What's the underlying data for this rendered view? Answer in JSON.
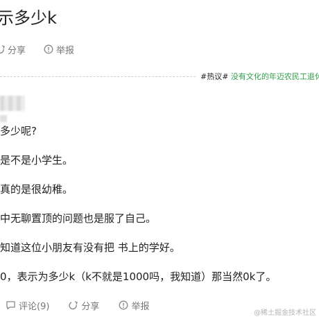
{
  "post": {
    "title": "示多少k"
  },
  "top_actions": {
    "share_label": "分享",
    "report_label": "举报"
  },
  "hashtag": {
    "prefix": "#热议#",
    "topic": " 没有文化的年迈农民工退休..."
  },
  "content": {
    "paragraphs": [
      "多少呢?",
      "是不是小学生。",
      "真的是很幼稚。",
      "中无聊置顶的问题也是服了自己。",
      "知道这位小朋友有没有把 书上的学好。",
      "0，表示为多少k（k不就是1000吗，我知道）那当然0k了。"
    ]
  },
  "bottom_actions": {
    "comment_label": "评论(9)",
    "share_label": "分享",
    "report_label": "举报"
  },
  "watermark": {
    "text": "@稀土掘金技术社区"
  },
  "colors": {
    "topic_green": "#2fa04a",
    "action_gray": "#777777"
  },
  "icons": {
    "share": "share-icon",
    "report": "report-icon",
    "comment": "comment-icon"
  }
}
